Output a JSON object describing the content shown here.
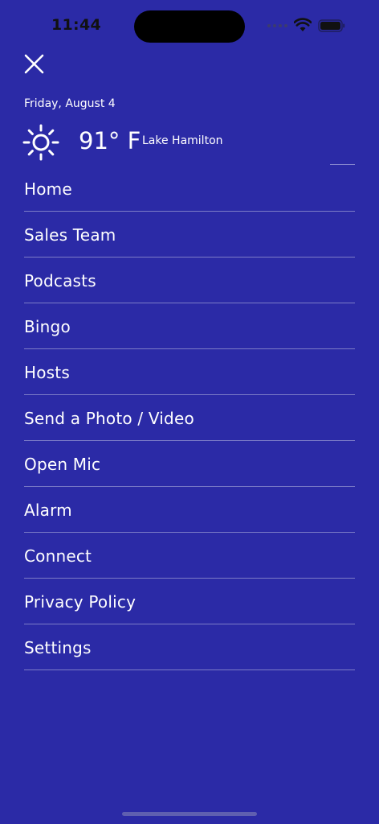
{
  "status_bar": {
    "time": "11:44"
  },
  "header": {
    "close_icon": "close-icon",
    "date": "Friday, August 4"
  },
  "weather": {
    "icon": "sun-icon",
    "temperature": "91° F",
    "location": "Lake Hamilton"
  },
  "menu": {
    "items": [
      {
        "label": "Home"
      },
      {
        "label": "Sales Team"
      },
      {
        "label": "Podcasts"
      },
      {
        "label": "Bingo"
      },
      {
        "label": "Hosts"
      },
      {
        "label": "Send a Photo / Video"
      },
      {
        "label": "Open Mic"
      },
      {
        "label": "Alarm"
      },
      {
        "label": "Connect"
      },
      {
        "label": "Privacy Policy"
      },
      {
        "label": "Settings"
      }
    ]
  },
  "colors": {
    "background": "#2b2aa6",
    "text": "#ffffff",
    "divider": "#7c7cc7"
  }
}
